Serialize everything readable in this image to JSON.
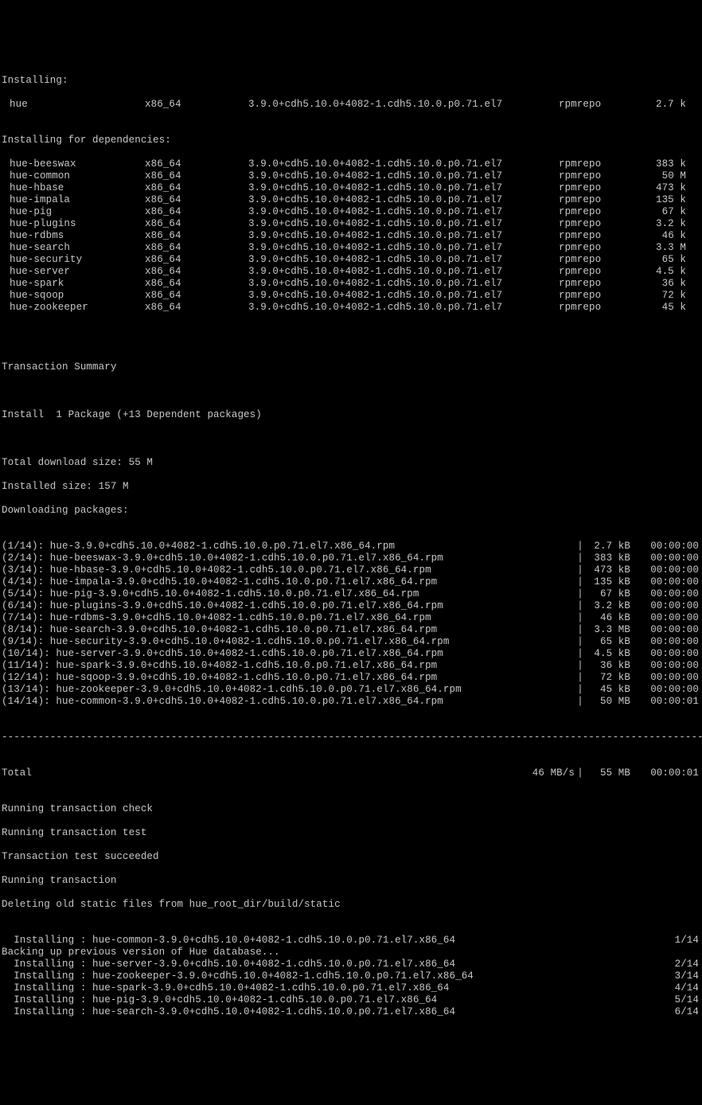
{
  "labels": {
    "installing": "Installing:",
    "installing_deps": "Installing for dependencies:",
    "trans_summary": "Transaction Summary",
    "install_summary": "Install  1 Package (+13 Dependent packages)",
    "total_dl": "Total download size: 55 M",
    "installed_sz": "Installed size: 157 M",
    "downloading": "Downloading packages:",
    "total": "Total",
    "total_rate": "46 MB/s",
    "total_size": "55 MB",
    "total_time": "00:00:01",
    "run_check": "Running transaction check",
    "run_test": "Running transaction test",
    "test_ok": "Transaction test succeeded",
    "run_trans": "Running transaction",
    "deleting": "Deleting old static files from hue_root_dir/build/static",
    "backing": "Backing up previous version of Hue database...",
    "dash": "-------------------------------------------------------------------------------------------------------------------------------------"
  },
  "main_pkg": {
    "name": "hue",
    "arch": "x86_64",
    "ver": "3.9.0+cdh5.10.0+4082-1.cdh5.10.0.p0.71.el7",
    "repo": "rpmrepo",
    "size": "2.7 k"
  },
  "deps": [
    {
      "name": "hue-beeswax",
      "arch": "x86_64",
      "ver": "3.9.0+cdh5.10.0+4082-1.cdh5.10.0.p0.71.el7",
      "repo": "rpmrepo",
      "size": "383 k"
    },
    {
      "name": "hue-common",
      "arch": "x86_64",
      "ver": "3.9.0+cdh5.10.0+4082-1.cdh5.10.0.p0.71.el7",
      "repo": "rpmrepo",
      "size": "50 M"
    },
    {
      "name": "hue-hbase",
      "arch": "x86_64",
      "ver": "3.9.0+cdh5.10.0+4082-1.cdh5.10.0.p0.71.el7",
      "repo": "rpmrepo",
      "size": "473 k"
    },
    {
      "name": "hue-impala",
      "arch": "x86_64",
      "ver": "3.9.0+cdh5.10.0+4082-1.cdh5.10.0.p0.71.el7",
      "repo": "rpmrepo",
      "size": "135 k"
    },
    {
      "name": "hue-pig",
      "arch": "x86_64",
      "ver": "3.9.0+cdh5.10.0+4082-1.cdh5.10.0.p0.71.el7",
      "repo": "rpmrepo",
      "size": "67 k"
    },
    {
      "name": "hue-plugins",
      "arch": "x86_64",
      "ver": "3.9.0+cdh5.10.0+4082-1.cdh5.10.0.p0.71.el7",
      "repo": "rpmrepo",
      "size": "3.2 k"
    },
    {
      "name": "hue-rdbms",
      "arch": "x86_64",
      "ver": "3.9.0+cdh5.10.0+4082-1.cdh5.10.0.p0.71.el7",
      "repo": "rpmrepo",
      "size": "46 k"
    },
    {
      "name": "hue-search",
      "arch": "x86_64",
      "ver": "3.9.0+cdh5.10.0+4082-1.cdh5.10.0.p0.71.el7",
      "repo": "rpmrepo",
      "size": "3.3 M"
    },
    {
      "name": "hue-security",
      "arch": "x86_64",
      "ver": "3.9.0+cdh5.10.0+4082-1.cdh5.10.0.p0.71.el7",
      "repo": "rpmrepo",
      "size": "65 k"
    },
    {
      "name": "hue-server",
      "arch": "x86_64",
      "ver": "3.9.0+cdh5.10.0+4082-1.cdh5.10.0.p0.71.el7",
      "repo": "rpmrepo",
      "size": "4.5 k"
    },
    {
      "name": "hue-spark",
      "arch": "x86_64",
      "ver": "3.9.0+cdh5.10.0+4082-1.cdh5.10.0.p0.71.el7",
      "repo": "rpmrepo",
      "size": "36 k"
    },
    {
      "name": "hue-sqoop",
      "arch": "x86_64",
      "ver": "3.9.0+cdh5.10.0+4082-1.cdh5.10.0.p0.71.el7",
      "repo": "rpmrepo",
      "size": "72 k"
    },
    {
      "name": "hue-zookeeper",
      "arch": "x86_64",
      "ver": "3.9.0+cdh5.10.0+4082-1.cdh5.10.0.p0.71.el7",
      "repo": "rpmrepo",
      "size": "45 k"
    }
  ],
  "downloads": [
    {
      "idx": "(1/14):",
      "file": "hue-3.9.0+cdh5.10.0+4082-1.cdh5.10.0.p0.71.el7.x86_64.rpm",
      "size": "2.7 kB",
      "time": "00:00:00"
    },
    {
      "idx": "(2/14):",
      "file": "hue-beeswax-3.9.0+cdh5.10.0+4082-1.cdh5.10.0.p0.71.el7.x86_64.rpm",
      "size": "383 kB",
      "time": "00:00:00"
    },
    {
      "idx": "(3/14):",
      "file": "hue-hbase-3.9.0+cdh5.10.0+4082-1.cdh5.10.0.p0.71.el7.x86_64.rpm",
      "size": "473 kB",
      "time": "00:00:00"
    },
    {
      "idx": "(4/14):",
      "file": "hue-impala-3.9.0+cdh5.10.0+4082-1.cdh5.10.0.p0.71.el7.x86_64.rpm",
      "size": "135 kB",
      "time": "00:00:00"
    },
    {
      "idx": "(5/14):",
      "file": "hue-pig-3.9.0+cdh5.10.0+4082-1.cdh5.10.0.p0.71.el7.x86_64.rpm",
      "size": "67 kB",
      "time": "00:00:00"
    },
    {
      "idx": "(6/14):",
      "file": "hue-plugins-3.9.0+cdh5.10.0+4082-1.cdh5.10.0.p0.71.el7.x86_64.rpm",
      "size": "3.2 kB",
      "time": "00:00:00"
    },
    {
      "idx": "(7/14):",
      "file": "hue-rdbms-3.9.0+cdh5.10.0+4082-1.cdh5.10.0.p0.71.el7.x86_64.rpm",
      "size": "46 kB",
      "time": "00:00:00"
    },
    {
      "idx": "(8/14):",
      "file": "hue-search-3.9.0+cdh5.10.0+4082-1.cdh5.10.0.p0.71.el7.x86_64.rpm",
      "size": "3.3 MB",
      "time": "00:00:00"
    },
    {
      "idx": "(9/14):",
      "file": "hue-security-3.9.0+cdh5.10.0+4082-1.cdh5.10.0.p0.71.el7.x86_64.rpm",
      "size": "65 kB",
      "time": "00:00:00"
    },
    {
      "idx": "(10/14):",
      "file": "hue-server-3.9.0+cdh5.10.0+4082-1.cdh5.10.0.p0.71.el7.x86_64.rpm",
      "size": "4.5 kB",
      "time": "00:00:00"
    },
    {
      "idx": "(11/14):",
      "file": "hue-spark-3.9.0+cdh5.10.0+4082-1.cdh5.10.0.p0.71.el7.x86_64.rpm",
      "size": "36 kB",
      "time": "00:00:00"
    },
    {
      "idx": "(12/14):",
      "file": "hue-sqoop-3.9.0+cdh5.10.0+4082-1.cdh5.10.0.p0.71.el7.x86_64.rpm",
      "size": "72 kB",
      "time": "00:00:00"
    },
    {
      "idx": "(13/14):",
      "file": "hue-zookeeper-3.9.0+cdh5.10.0+4082-1.cdh5.10.0.p0.71.el7.x86_64.rpm",
      "size": "45 kB",
      "time": "00:00:00"
    },
    {
      "idx": "(14/14):",
      "file": "hue-common-3.9.0+cdh5.10.0+4082-1.cdh5.10.0.p0.71.el7.x86_64.rpm",
      "size": "50 MB",
      "time": "00:00:01"
    }
  ],
  "installing_steps": [
    {
      "line": "  Installing : hue-common-3.9.0+cdh5.10.0+4082-1.cdh5.10.0.p0.71.el7.x86_64",
      "prog": "1/14"
    },
    {
      "line": "  Installing : hue-server-3.9.0+cdh5.10.0+4082-1.cdh5.10.0.p0.71.el7.x86_64",
      "prog": "2/14"
    },
    {
      "line": "  Installing : hue-zookeeper-3.9.0+cdh5.10.0+4082-1.cdh5.10.0.p0.71.el7.x86_64",
      "prog": "3/14"
    },
    {
      "line": "  Installing : hue-spark-3.9.0+cdh5.10.0+4082-1.cdh5.10.0.p0.71.el7.x86_64",
      "prog": "4/14"
    },
    {
      "line": "  Installing : hue-pig-3.9.0+cdh5.10.0+4082-1.cdh5.10.0.p0.71.el7.x86_64",
      "prog": "5/14"
    },
    {
      "line": "  Installing : hue-search-3.9.0+cdh5.10.0+4082-1.cdh5.10.0.p0.71.el7.x86_64",
      "prog": "6/14"
    }
  ]
}
